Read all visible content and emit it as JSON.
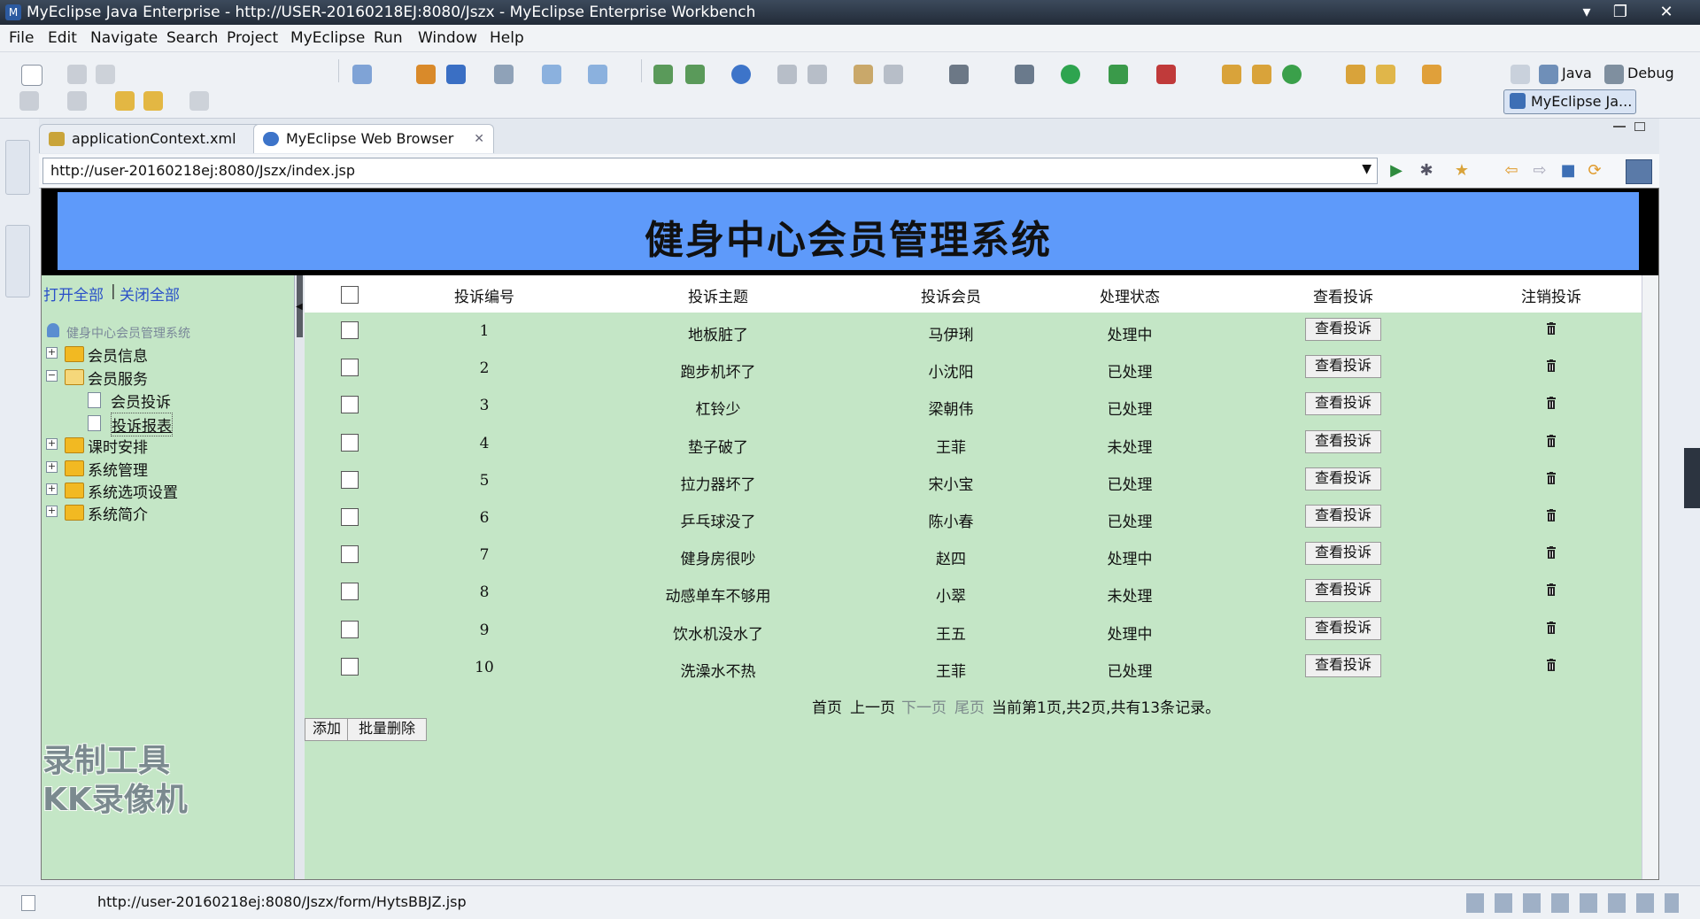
{
  "window": {
    "title": "MyEclipse Java Enterprise - http://USER-20160218EJ:8080/Jszx - MyEclipse Enterprise Workbench",
    "controls": [
      "▾",
      "❐",
      "✕"
    ]
  },
  "menu": [
    "File",
    "Edit",
    "Navigate",
    "Search",
    "Project",
    "MyEclipse",
    "Run",
    "Window",
    "Help"
  ],
  "perspectives": {
    "java": "Java",
    "debug": "Debug",
    "myeclipse": "MyEclipse Ja..."
  },
  "editor_tabs": [
    {
      "label": "applicationContext.xml",
      "active": false
    },
    {
      "label": "MyEclipse Web Browser",
      "active": true,
      "close": "✕"
    }
  ],
  "browser": {
    "url": "http://user-20160218ej:8080/Jszx/index.jsp"
  },
  "page": {
    "banner_title": "健身中心会员管理系统",
    "nav": {
      "open_all": "打开全部",
      "separator": "|",
      "close_all": "关闭全部",
      "root": "健身中心会员管理系统",
      "items": [
        {
          "label": "会员信息",
          "expanded": false
        },
        {
          "label": "会员服务",
          "expanded": true,
          "children": [
            "会员投诉",
            "投诉报表"
          ]
        },
        {
          "label": "课时安排",
          "expanded": false
        },
        {
          "label": "系统管理",
          "expanded": false
        },
        {
          "label": "系统选项设置",
          "expanded": false
        },
        {
          "label": "系统简介",
          "expanded": false
        }
      ]
    },
    "table": {
      "headers": [
        "投诉编号",
        "投诉主题",
        "投诉会员",
        "处理状态",
        "查看投诉",
        "注销投诉"
      ],
      "view_button": "查看投诉",
      "rows": [
        {
          "id": "1",
          "subject": "地板脏了",
          "member": "马伊琍",
          "status": "处理中"
        },
        {
          "id": "2",
          "subject": "跑步机坏了",
          "member": "小沈阳",
          "status": "已处理"
        },
        {
          "id": "3",
          "subject": "杠铃少",
          "member": "梁朝伟",
          "status": "已处理"
        },
        {
          "id": "4",
          "subject": "垫子破了",
          "member": "王菲",
          "status": "未处理"
        },
        {
          "id": "5",
          "subject": "拉力器坏了",
          "member": "宋小宝",
          "status": "已处理"
        },
        {
          "id": "6",
          "subject": "乒乓球没了",
          "member": "陈小春",
          "status": "已处理"
        },
        {
          "id": "7",
          "subject": "健身房很吵",
          "member": "赵四",
          "status": "处理中"
        },
        {
          "id": "8",
          "subject": "动感单车不够用",
          "member": "小翠",
          "status": "未处理"
        },
        {
          "id": "9",
          "subject": "饮水机没水了",
          "member": "王五",
          "status": "处理中"
        },
        {
          "id": "10",
          "subject": "洗澡水不热",
          "member": "王菲",
          "status": "已处理"
        }
      ]
    },
    "pager": {
      "first": "首页",
      "prev": "上一页",
      "next": "下一页",
      "last": "尾页",
      "info": "当前第1页,共2页,共有13条记录。"
    },
    "actions": {
      "add": "添加",
      "batch_delete": "批量删除"
    }
  },
  "watermark": [
    "录制工具",
    "KK录像机"
  ],
  "status_bar": {
    "message": "http://user-20160218ej:8080/Jszx/form/HytsBBJZ.jsp"
  },
  "colors": {
    "banner": "#5e9afa",
    "content_bg": "#c4e6c6",
    "link": "#2a50c8"
  }
}
